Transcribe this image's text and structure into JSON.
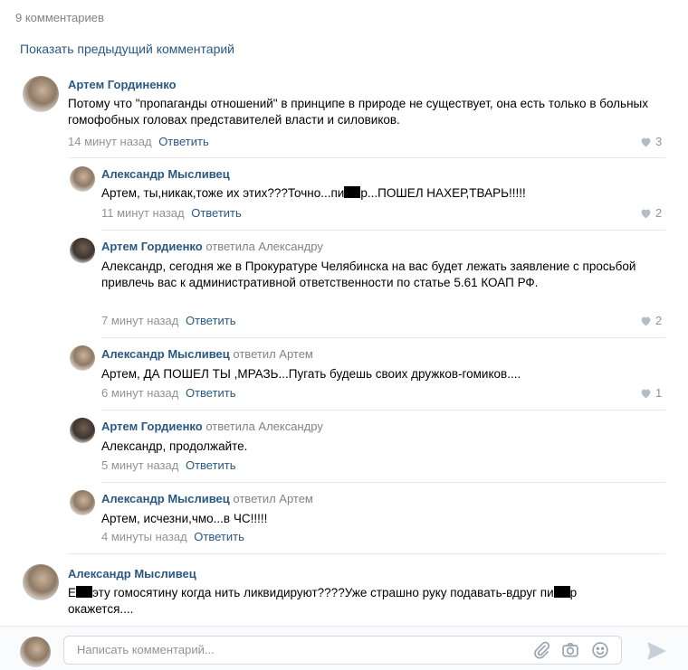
{
  "header": {
    "count_label": "9 комментариев",
    "show_previous": "Показать предыдущий комментарий"
  },
  "comments": [
    {
      "author": "Артем Гординенко",
      "reply_to": "",
      "text": "Потому что \"пропаганды отношений\" в принципе в природе не существует, она есть только в больных гомофобных головах представителей власти и силовиков.",
      "time": "14 минут назад",
      "reply_label": "Ответить",
      "likes": "3"
    },
    {
      "author": "Александр Мысливец",
      "reply_to": "",
      "text_before": "Артем, ты,никак,тоже их этих???Точно...пи",
      "text_after": "р...ПОШЕЛ НАХЕР,ТВАРЬ!!!!!",
      "time": "11 минут назад",
      "reply_label": "Ответить",
      "likes": "2"
    },
    {
      "author": "Артем Гордиенко",
      "reply_to": "ответила Александру",
      "text": "Александр, сегодня же в Прокуратуре Челябинска на вас будет лежать заявление с просьбой привлечь вас к административной ответственности по статье 5.61 КОАП РФ.",
      "time": "7 минут назад",
      "reply_label": "Ответить",
      "likes": "2"
    },
    {
      "author": "Александр Мысливец",
      "reply_to": "ответил Артем",
      "text": "Артем, ДА ПОШЕЛ ТЫ ,МРАЗЬ...Пугать будешь своих дружков-гомиков....",
      "time": "6 минут назад",
      "reply_label": "Ответить",
      "likes": "1"
    },
    {
      "author": "Артем Гордиенко",
      "reply_to": "ответила Александру",
      "text": "Александр, продолжайте.",
      "time": "5 минут назад",
      "reply_label": "Ответить",
      "likes": ""
    },
    {
      "author": "Александр Мысливец",
      "reply_to": "ответил Артем",
      "text": "Артем, исчезни,чмо...в ЧС!!!!!",
      "time": "4 минуты назад",
      "reply_label": "Ответить",
      "likes": ""
    },
    {
      "author": "Александр Мысливец",
      "reply_to": "",
      "text_start": "Е",
      "text_middle": "эту гомосятину когда нить ликвидируют????Уже страшно руку подавать-вдруг пи",
      "text_end": "р",
      "text_line2": "окажется....",
      "time": "",
      "reply_label": "",
      "likes": ""
    }
  ],
  "composer": {
    "placeholder": "Написать комментарий...",
    "icons": [
      "paperclip-icon",
      "camera-icon",
      "emoji-icon",
      "send-icon"
    ]
  },
  "colors": {
    "link": "#2a5885",
    "meta": "#939393",
    "separator": "#e7e8ec"
  }
}
